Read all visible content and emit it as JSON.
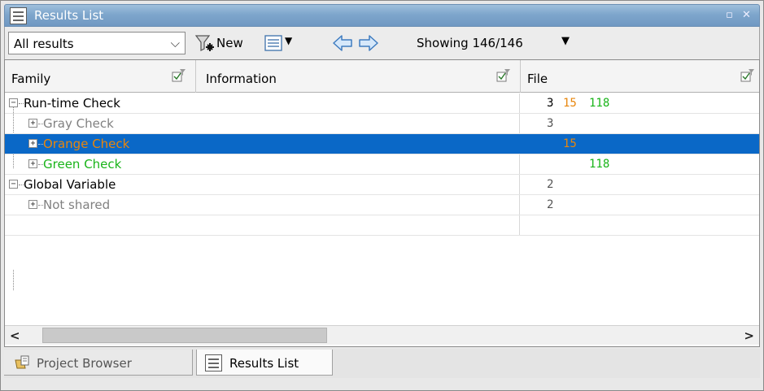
{
  "window": {
    "title": "Results List",
    "restore_glyph": "▫",
    "close_glyph": "✕"
  },
  "toolbar": {
    "filter_value": "All results",
    "new_label": "New",
    "showing_label": "Showing 146/146"
  },
  "table": {
    "columns": [
      "Family",
      "Information",
      "File"
    ],
    "rows": [
      {
        "label": "Run-time Check",
        "level": 0,
        "expanded": true,
        "color": "#000000",
        "selected": false
      },
      {
        "label": "Gray Check",
        "level": 1,
        "expanded": false,
        "color": "#808080",
        "selected": false
      },
      {
        "label": "Orange Check",
        "level": 1,
        "expanded": false,
        "color": "#e8860c",
        "selected": true
      },
      {
        "label": "Green Check",
        "level": 1,
        "expanded": false,
        "color": "#19b419",
        "selected": false
      },
      {
        "label": "Global Variable",
        "level": 0,
        "expanded": true,
        "color": "#000000",
        "selected": false
      },
      {
        "label": "Not shared",
        "level": 1,
        "expanded": false,
        "color": "#808080",
        "selected": false
      }
    ],
    "file_values": {
      "run_time": [
        "3",
        "15",
        "118"
      ],
      "gray": "3",
      "orange": "15",
      "green": "118",
      "global": "2",
      "not_shared": "2"
    }
  },
  "tabs": [
    {
      "label": "Project Browser",
      "active": false
    },
    {
      "label": "Results List",
      "active": true
    }
  ],
  "colors": {
    "title_bar": "#7ea6cc",
    "selection": "#0a68c7",
    "gray": "#808080",
    "orange": "#e8860c",
    "green": "#19b419"
  },
  "icons": [
    "results-list-icon",
    "filter-new-icon",
    "columns-icon",
    "back-arrow-icon",
    "forward-arrow-icon",
    "column-filter-icon",
    "project-browser-icon"
  ]
}
